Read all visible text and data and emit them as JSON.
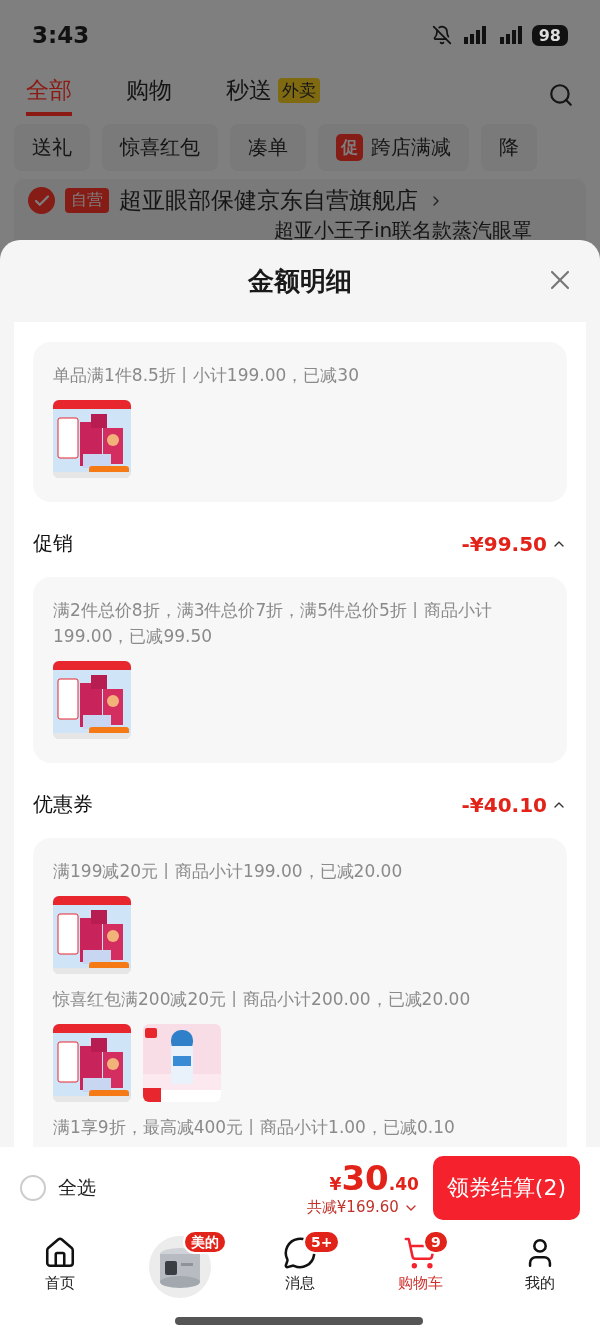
{
  "status_bar": {
    "time": "3:43",
    "battery": "98"
  },
  "top_tabs": [
    {
      "label": "全部",
      "selected": true
    },
    {
      "label": "购物",
      "selected": false
    },
    {
      "label": "秒送",
      "badge": "外卖",
      "selected": false
    }
  ],
  "filter_chips": [
    {
      "label": "送礼"
    },
    {
      "label": "惊喜红包"
    },
    {
      "label": "凑单"
    },
    {
      "label": "跨店满减",
      "tag": "促"
    },
    {
      "label": "降"
    }
  ],
  "store": {
    "checked": true,
    "tag": "自营",
    "name": "超亚眼部保健京东自营旗舰店",
    "item_title": "超亚小王子in联名款蒸汽眼罩"
  },
  "sheet": {
    "title": "金额明细",
    "sections": [
      {
        "rules": [
          {
            "text": "单品满1件8.5折丨小计199.00，已减30"
          }
        ]
      },
      {
        "title": "促销",
        "amount": "-¥99.50",
        "expanded": true,
        "rules": [
          {
            "text": "满2件总价8折，满3件总价7折，满5件总价5折丨商品小计199.00，已减99.50"
          }
        ]
      },
      {
        "title": "优惠券",
        "amount": "-¥40.10",
        "expanded": true,
        "rules": [
          {
            "text": "满199减20元丨商品小计199.00，已减20.00"
          },
          {
            "text": "惊喜红包满200减20元丨商品小计200.00，已减20.00"
          },
          {
            "text": "满1享9折，最高减400元丨商品小计1.00，已减0.10"
          }
        ]
      }
    ]
  },
  "bottom_bar": {
    "select_all": {
      "label": "全选",
      "checked": false
    },
    "currency": "¥",
    "price_integer": "30",
    "price_decimal": ".40",
    "saved": "共减¥169.60",
    "checkout": "领券结算(2)"
  },
  "tab_bar": [
    {
      "kind": "home",
      "label": "首页",
      "selected": false
    },
    {
      "kind": "picture",
      "badge": "美的"
    },
    {
      "kind": "message",
      "label": "消息",
      "badge": "5+",
      "selected": false
    },
    {
      "kind": "cart",
      "label": "购物车",
      "badge": "9",
      "selected": true
    },
    {
      "kind": "profile",
      "label": "我的",
      "selected": false
    }
  ]
}
